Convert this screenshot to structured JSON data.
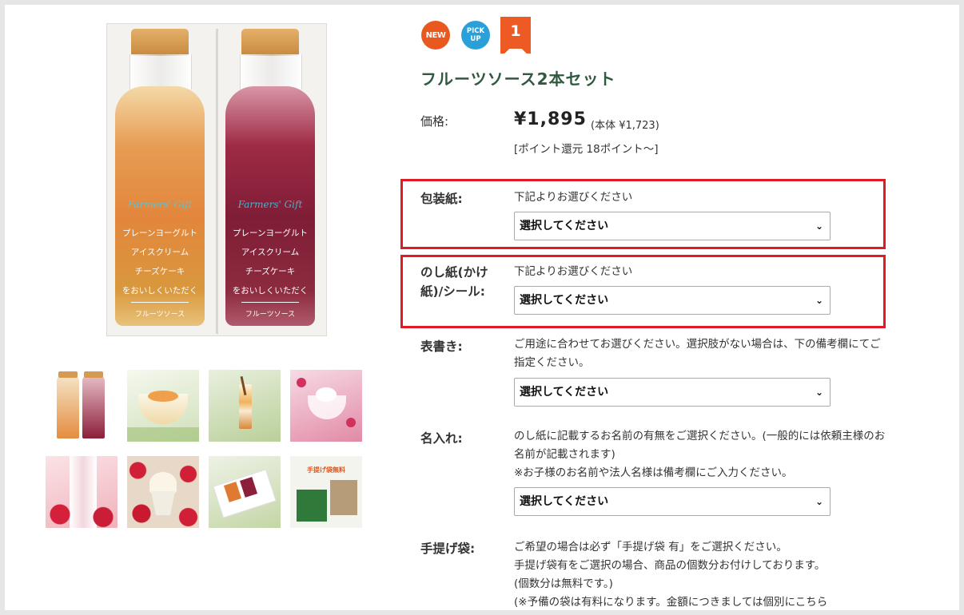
{
  "badges": {
    "new": "NEW",
    "pick_line1": "PICK",
    "pick_line2": "UP",
    "rank": "1"
  },
  "product": {
    "title": "フルーツソース2本セット",
    "price_label": "価格:",
    "price": "¥1,895",
    "price_tax": "(本体 ¥1,723)",
    "points": "[ポイント還元 18ポイント〜]"
  },
  "main_image": {
    "brand": "Farmers' Gift",
    "lines": [
      "プレーンヨーグルト",
      "アイスクリーム",
      "チーズケーキ",
      "をおいしくいただく"
    ],
    "footer": "フルーツソース"
  },
  "options": {
    "wrapping": {
      "label": "包装紙:",
      "note": "下記よりお選びください",
      "select_value": "選択してください"
    },
    "noshi": {
      "label_line1": "のし紙(かけ",
      "label_line2": "紙)/シール:",
      "note": "下記よりお選びください",
      "select_value": "選択してください"
    },
    "omotegaki": {
      "label": "表書き:",
      "note": "ご用途に合わせてお選びください。選択肢がない場合は、下の備考欄にてご指定ください。",
      "select_value": "選択してください"
    },
    "naire": {
      "label": "名入れ:",
      "note_line1": "のし紙に記載するお名前の有無をご選択ください。(一般的には依頼主様のお名前が記載されます)",
      "note_line2": "※お子様のお名前や法人名様は備考欄にご入力ください。",
      "select_value": "選択してください"
    },
    "bag": {
      "label": "手提げ袋:",
      "note_line1": "ご希望の場合は必ず「手提げ袋 有」をご選択ください。",
      "note_line2": "手提げ袋有をご選択の場合、商品の個数分お付けしております。",
      "note_line3": "(個数分は無料です。)",
      "note_line4": "(※予備の袋は有料になります。金額につきましては個別にこちら"
    }
  },
  "thumbnail_notice": {
    "line1": "手提げ袋無料"
  },
  "colors": {
    "title": "#2f5a3f",
    "highlight": "#e01b24",
    "badge_new": "#e9581f",
    "badge_pick": "#2aa0d8",
    "rank": "#ee5a24"
  }
}
